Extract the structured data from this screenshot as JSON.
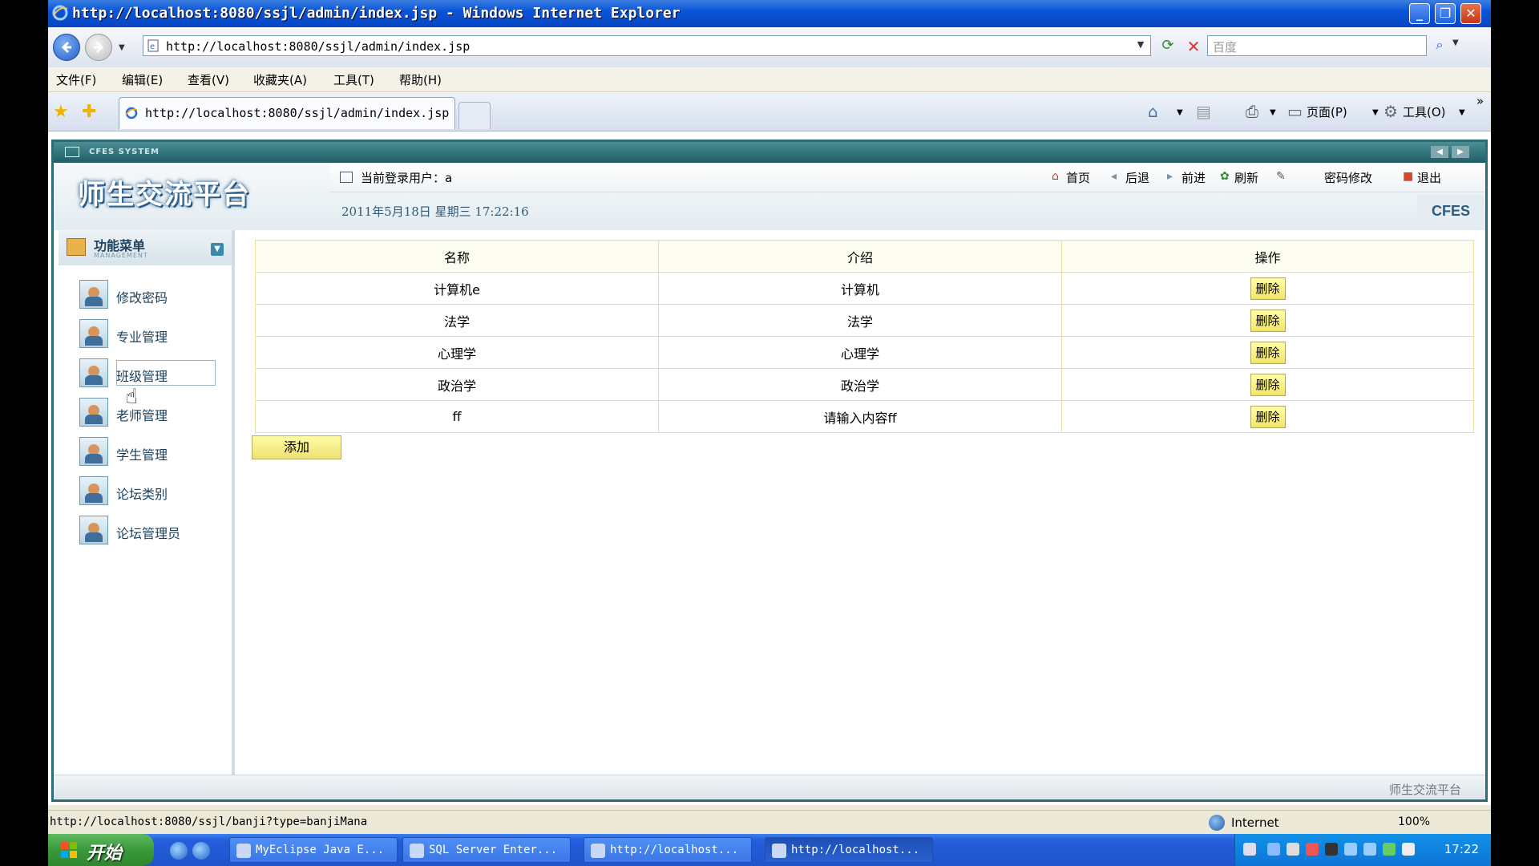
{
  "window": {
    "title": "http://localhost:8080/ssjl/admin/index.jsp - Windows Internet Explorer"
  },
  "addressbar": {
    "url": "http://localhost:8080/ssjl/admin/index.jsp",
    "search_placeholder": "百度"
  },
  "menubar": [
    "文件(F)",
    "编辑(E)",
    "查看(V)",
    "收藏夹(A)",
    "工具(T)",
    "帮助(H)"
  ],
  "tab": {
    "label": "http://localhost:8080/ssjl/admin/index.jsp"
  },
  "commandbar": {
    "page_label": "页面(P)",
    "tools_label": "工具(O)"
  },
  "site": {
    "system_label": "CFES SYSTEM",
    "logo": "师生交流平台",
    "current_user": "当前登录用户：a",
    "nav": [
      "首页",
      "后退",
      "前进",
      "刷新",
      "密码修改",
      "退出"
    ],
    "datetime": "2011年5月18日  星期三  17:22:16",
    "brand": "CFES",
    "footer": "师生交流平台"
  },
  "sidebar": {
    "title": "功能菜单",
    "subtitle": "MANAGEMENT",
    "items": [
      "修改密码",
      "专业管理",
      "班级管理",
      "老师管理",
      "学生管理",
      "论坛类别",
      "论坛管理员"
    ]
  },
  "table": {
    "headers": [
      "名称",
      "介绍",
      "操作"
    ],
    "rows": [
      {
        "name": "计算机e",
        "intro": "计算机",
        "action": "删除"
      },
      {
        "name": "法学",
        "intro": "法学",
        "action": "删除"
      },
      {
        "name": "心理学",
        "intro": "心理学",
        "action": "删除"
      },
      {
        "name": "政治学",
        "intro": "政治学",
        "action": "删除"
      },
      {
        "name": "ff",
        "intro": "请输入内容ff",
        "action": "删除"
      }
    ],
    "add_label": "添加"
  },
  "statusbar": {
    "link": "http://localhost:8080/ssjl/banji?type=banjiMana",
    "zone": "Internet",
    "zoom": "100%"
  },
  "taskbar": {
    "start": "开始",
    "tasks": [
      "MyEclipse Java E...",
      "SQL Server Enter...",
      "http://localhost...",
      "http://localhost..."
    ],
    "clock": "17:22"
  },
  "colors": {
    "frame": "#2C6B72",
    "table_border": "#E8E1A6",
    "button_fill": "#F2E36A"
  }
}
